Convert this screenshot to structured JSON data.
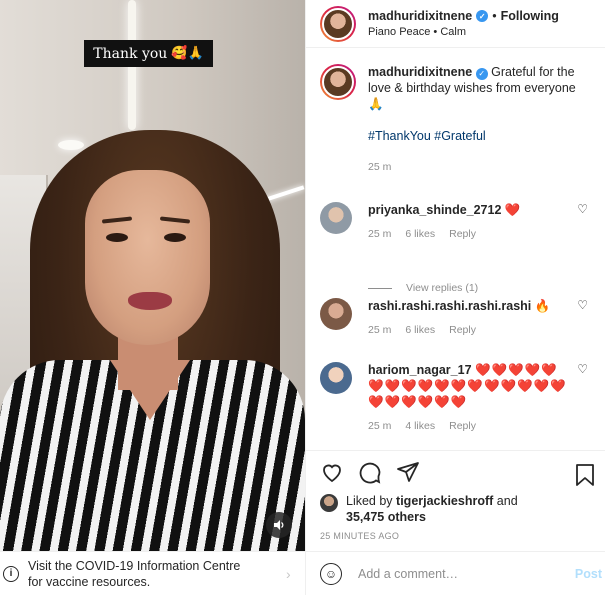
{
  "media": {
    "caption": "Thank you",
    "caption_emojis": "🥰🙏",
    "sound_icon": "speaker-icon"
  },
  "covid_banner": {
    "text": "Visit the COVID-19 Information Centre for vaccine resources.",
    "icon": "info-icon"
  },
  "header": {
    "username": "madhuridixitnene",
    "follow_status": "Following",
    "separator": "•",
    "audio": "Piano Peace • Calm"
  },
  "post": {
    "username": "madhuridixitnene",
    "caption": "Grateful for the love & birthday wishes from everyone🙏",
    "hashtags": "#ThankYou #Grateful",
    "time": "25 m"
  },
  "comments": [
    {
      "user": "priyanka_shinde_2712",
      "text": "❤️",
      "time": "25 m",
      "likes": "6 likes",
      "reply": "Reply",
      "avatar_color": "#c9d2d8"
    },
    {
      "user": "rashi.rashi.rashi.rashi.rashi",
      "text": "🔥",
      "time": "25 m",
      "likes": "6 likes",
      "reply": "Reply",
      "avatar_color": "#b28b74"
    },
    {
      "user": "hariom_nagar_17",
      "text": "❤️❤️❤️❤️❤️❤️❤️❤️❤️❤️❤️❤️❤️❤️❤️❤️❤️❤️❤️❤️❤️❤️❤️",
      "time": "25 m",
      "likes": "4 likes",
      "reply": "Reply",
      "avatar_color": "#6f86a3"
    }
  ],
  "view_replies": "View replies (1)",
  "likes": {
    "prefix": "Liked by",
    "user": "tigerjackieshroff",
    "and": "and",
    "count": "35,475 others"
  },
  "time_ago": "25 MINUTES AGO",
  "add_comment": {
    "placeholder": "Add a comment…",
    "post_label": "Post"
  },
  "colors": {
    "accent": "#3897f0",
    "heart": "#ed4956",
    "post_disabled": "#b2dffc"
  }
}
